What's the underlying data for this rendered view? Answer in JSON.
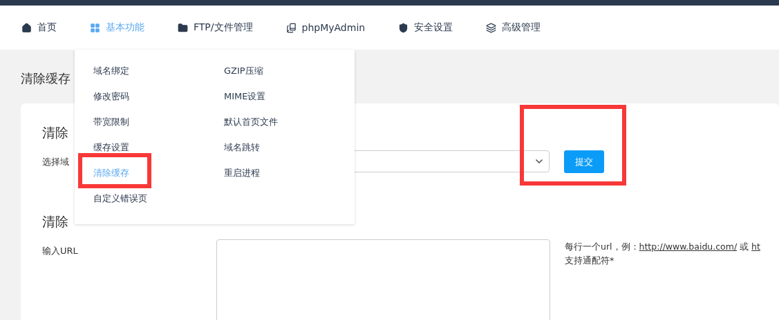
{
  "nav": [
    {
      "label": "首页",
      "kind": "home",
      "selected": false
    },
    {
      "label": "基本功能",
      "kind": "grid",
      "selected": true
    },
    {
      "label": "FTP/文件管理",
      "kind": "folder",
      "selected": false
    },
    {
      "label": "phpMyAdmin",
      "kind": "book",
      "selected": false
    },
    {
      "label": "安全设置",
      "kind": "shield",
      "selected": false
    },
    {
      "label": "高级管理",
      "kind": "layers",
      "selected": false
    }
  ],
  "dropdown": {
    "columns": [
      [
        {
          "label": "域名绑定",
          "selected": false
        },
        {
          "label": "修改密码",
          "selected": false
        },
        {
          "label": "带宽限制",
          "selected": false
        },
        {
          "label": "缓存设置",
          "selected": false
        },
        {
          "label": "清除缓存",
          "selected": true
        },
        {
          "label": "自定义错误页",
          "selected": false
        }
      ],
      [
        {
          "label": "GZIP压缩",
          "selected": false
        },
        {
          "label": "MIME设置",
          "selected": false
        },
        {
          "label": "默认首页文件",
          "selected": false
        },
        {
          "label": "域名跳转",
          "selected": false
        },
        {
          "label": "重启进程",
          "selected": false
        }
      ]
    ]
  },
  "page_title": "清除缓存",
  "section_1": {
    "heading": "清除",
    "label": "选择域",
    "button": "提交"
  },
  "section_2": {
    "heading": "清除",
    "label": "输入URL",
    "help": {
      "prefix": "每行一个url，例：",
      "link": "http://www.baidu.com/",
      "middle": " 或 ",
      "link_2": "ht",
      "line_2": "支持通配符*"
    }
  }
}
